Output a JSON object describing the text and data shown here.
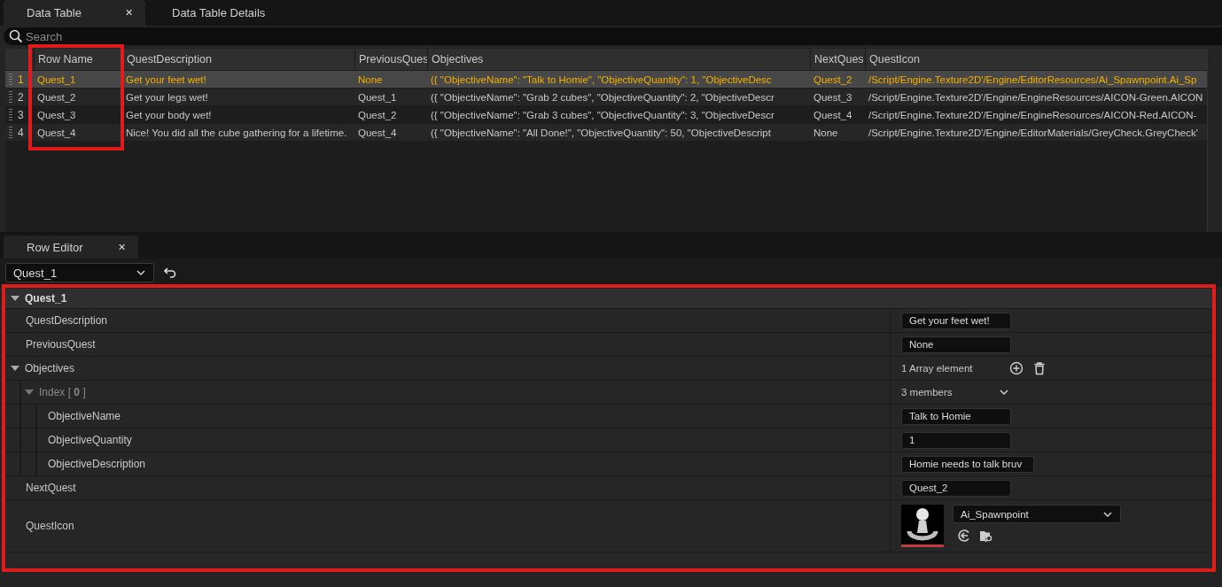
{
  "top_tabs": [
    {
      "label": "Data Table",
      "selected": true,
      "close": "✕"
    },
    {
      "label": "Data Table Details",
      "selected": false
    }
  ],
  "search": {
    "placeholder": "Search"
  },
  "table": {
    "columns": [
      "Row Name",
      "QuestDescription",
      "PreviousQues",
      "Objectives",
      "NextQues",
      "QuestIcon"
    ],
    "rows": [
      {
        "number": "1",
        "selected": true,
        "cells": [
          "Quest_1",
          "Get your feet wet!",
          "None",
          "({ \"ObjectiveName\": \"Talk to Homie\", \"ObjectiveQuantity\": 1, \"ObjectiveDesc",
          "Quest_2",
          "/Script/Engine.Texture2D'/Engine/EditorResources/Ai_Spawnpoint.Ai_Sp"
        ]
      },
      {
        "number": "2",
        "selected": false,
        "cells": [
          "Quest_2",
          "Get your legs wet!",
          "Quest_1",
          "({ \"ObjectiveName\": \"Grab 2 cubes\", \"ObjectiveQuantity\": 2, \"ObjectiveDescr",
          "Quest_3",
          "/Script/Engine.Texture2D'/Engine/EngineResources/AICON-Green.AICON"
        ]
      },
      {
        "number": "3",
        "selected": false,
        "cells": [
          "Quest_3",
          "Get your body wet!",
          "Quest_2",
          "({ \"ObjectiveName\": \"Grab 3 cubes\", \"ObjectiveQuantity\": 3, \"ObjectiveDescr",
          "Quest_4",
          "/Script/Engine.Texture2D'/Engine/EngineResources/AICON-Red.AICON-"
        ]
      },
      {
        "number": "4",
        "selected": false,
        "cells": [
          "Quest_4",
          "Nice! You did all the cube gathering for a lifetime.",
          "Quest_4",
          "({ \"ObjectiveName\": \"All Done!\", \"ObjectiveQuantity\": 50, \"ObjectiveDescript",
          "None",
          "/Script/Engine.Texture2D'/Engine/EditorMaterials/GreyCheck.GreyCheck'"
        ]
      }
    ]
  },
  "row_editor": {
    "tab": {
      "label": "Row Editor",
      "selected": true,
      "close": "✕"
    },
    "row_select": {
      "value": "Quest_1"
    },
    "properties": {
      "kind": "category",
      "label": "Quest_1",
      "expanded": true,
      "children": [
        {
          "kind": "field",
          "label": "QuestDescription",
          "value": "Get your feet wet!"
        },
        {
          "kind": "field",
          "label": "PreviousQuest",
          "value": "None"
        },
        {
          "kind": "array",
          "label": "Objectives",
          "expanded": true,
          "summary": "1 Array element",
          "children": [
            {
              "kind": "struct",
              "label": "Index [ **0** ]",
              "expanded": true,
              "summary": "3 members",
              "children": [
                {
                  "kind": "field",
                  "label": "ObjectiveName",
                  "value": "Talk to Homie"
                },
                {
                  "kind": "field",
                  "label": "ObjectiveQuantity",
                  "value": "1"
                },
                {
                  "kind": "field",
                  "label": "ObjectiveDescription",
                  "value": "Homie needs to talk bruv"
                }
              ]
            }
          ]
        },
        {
          "kind": "field",
          "label": "NextQuest",
          "value": "Quest_2"
        },
        {
          "kind": "asset",
          "label": "QuestIcon",
          "value": "Ai_Spawnpoint"
        }
      ]
    }
  }
}
